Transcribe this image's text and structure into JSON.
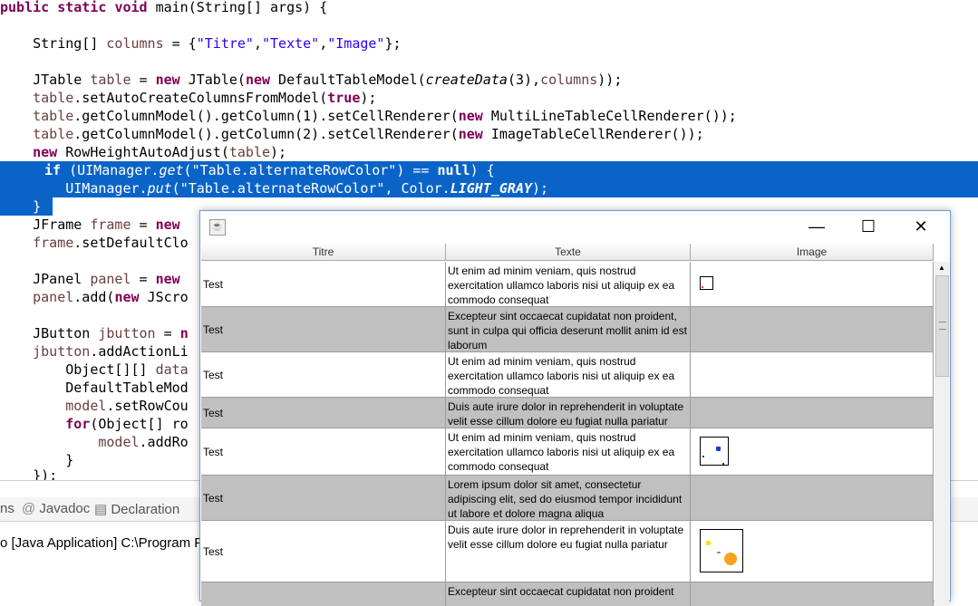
{
  "code": {
    "lines": [
      {
        "kind": "main"
      },
      {
        "kind": "blank"
      },
      {
        "kind": "columns"
      },
      {
        "kind": "blank"
      },
      {
        "kind": "jtable"
      },
      {
        "kind": "autoCreate"
      },
      {
        "kind": "renderer1"
      },
      {
        "kind": "renderer2"
      },
      {
        "kind": "rowHeight"
      },
      {
        "kind": "if"
      },
      {
        "kind": "put"
      },
      {
        "kind": "close"
      }
    ],
    "t": {
      "public": "public",
      "static": "static",
      "void": "void",
      "main": " main(String[] args) {",
      "columns_decl": "    String[] ",
      "columns_var": "columns",
      "columns_eq": " = {",
      "s1": "\"Titre\"",
      "comma": ",",
      "s2": "\"Texte\"",
      "s3": "\"Image\"",
      "columns_end": "};",
      "jt1": "    JTable ",
      "jt_var": "table",
      "jt_eq": " = ",
      "new": "new",
      "jt2": " JTable(",
      "jt3": " DefaultTableModel(",
      "createData": "createData",
      "jt4": "(3),",
      "jt5": "));",
      "auto1": "    ",
      "auto_var": "table",
      "auto2": ".setAutoCreateColumnsFromModel(",
      "true": "true",
      "auto3": ");",
      "r1a": ".getColumnModel().getColumn(1).setCellRenderer(",
      "r1b": " MultiLineTableCellRenderer());",
      "r2a": ".getColumnModel().getColumn(2).setCellRenderer(",
      "r2b": " ImageTableCellRenderer());",
      "rh1": " RowHeightAutoAdjust(",
      "rh2": ");",
      "if": "if",
      "if1": " (UIManager.",
      "get": "get",
      "if2": "(",
      "alt_str": "\"Table.alternateRowColor\"",
      "if3": ") == ",
      "null": "null",
      "if4": ") {",
      "put1": "        UIManager.",
      "put": "put",
      "put2": "(",
      "put3": ", Color.",
      "light_gray": "LIGHT_GRAY",
      "put4": ");",
      "close": "    }",
      "jframe1": "    JFrame ",
      "jframe_var": "frame",
      "jframe2": " = ",
      "jframe_new": "new",
      "frame_set": ".setDefaultClo",
      "jpanel1": "    JPanel ",
      "jpanel_var": "panel",
      "jpanel2": " = ",
      "jpanel_new": "new",
      "panel_add": ".add(",
      "panel_new": "new",
      "panel_rest": " JScro",
      "jbutton1": "    JButton ",
      "jbutton_var": "jbutton",
      "jbutton2": " = ",
      "jbutton_n": "n",
      "jbutton_add": ".addActionLi",
      "obj": "        Object[][] ",
      "obj_var": "data",
      "dtm": "        DefaultTableMod",
      "model_var": "model",
      "model_set": ".setRowCou",
      "for": "for",
      "for_rest": "(Object[] ro",
      "model_add": ".addRo",
      "brace1": "        }",
      "brace2": "    });"
    }
  },
  "bottom": {
    "tabs": [
      "ns",
      "Javadoc",
      "Declaration"
    ],
    "console": "o [Java Application] C:\\Program Fi"
  },
  "window": {
    "columns": [
      "Titre",
      "Texte",
      "Image"
    ],
    "rows": [
      {
        "title": "Test",
        "text": "Ut enim ad minim veniam, quis nostrud exercitation ullamco laboris nisi ut aliquip ex ea commodo consequat",
        "alt": false,
        "img": "small"
      },
      {
        "title": "Test",
        "text": "Excepteur sint occaecat cupidatat non proident, sunt in culpa qui officia deserunt mollit anim id est laborum",
        "alt": true,
        "img": ""
      },
      {
        "title": "Test",
        "text": "Ut enim ad minim veniam, quis nostrud exercitation ullamco laboris nisi ut aliquip ex ea commodo consequat",
        "alt": false,
        "img": ""
      },
      {
        "title": "Test",
        "text": "Duis aute irure dolor in reprehenderit in voluptate velit esse cillum dolore eu fugiat nulla pariatur",
        "alt": true,
        "img": ""
      },
      {
        "title": "Test",
        "text": "Ut enim ad minim veniam, quis nostrud exercitation ullamco laboris nisi ut aliquip ex ea commodo consequat",
        "alt": false,
        "img": "medium"
      },
      {
        "title": "Test",
        "text": "Lorem ipsum dolor sit amet, consectetur adipiscing elit, sed do eiusmod tempor incididunt ut labore et dolore magna aliqua",
        "alt": true,
        "img": ""
      },
      {
        "title": "Test",
        "text": "Duis aute irure dolor in reprehenderit in voluptate velit esse cillum dolore eu fugiat nulla pariatur",
        "alt": false,
        "img": "large"
      },
      {
        "title": "",
        "text": "Excepteur sint occaecat cupidatat non proident",
        "alt": true,
        "img": ""
      }
    ],
    "controls": {
      "minimize": "—",
      "maximize": "☐",
      "close": "✕"
    }
  },
  "colors": {
    "selection": "#0a64c8",
    "alt_row": "#c0c0c0",
    "keyword": "#7f0055",
    "string": "#2a00ff"
  }
}
